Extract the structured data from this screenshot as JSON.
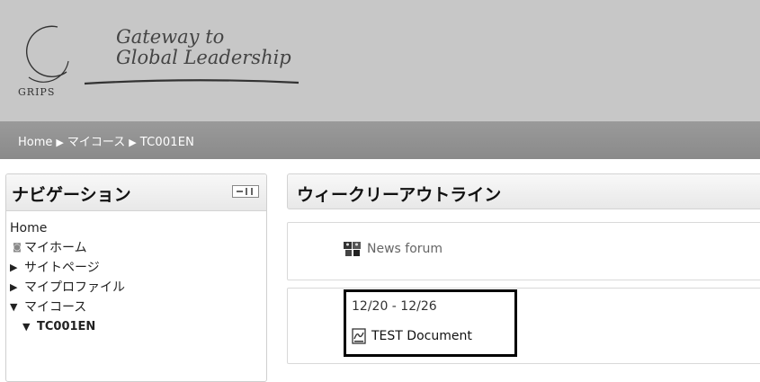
{
  "header": {
    "logo_text": "GRIPS",
    "tagline_line1": "Gateway to",
    "tagline_line2": "Global Leadership"
  },
  "breadcrumb": {
    "items": [
      "Home",
      "マイコース",
      "TC001EN"
    ],
    "separator": "▶"
  },
  "navigation": {
    "title": "ナビゲーション",
    "home": "Home",
    "items": [
      {
        "label": "マイホーム",
        "icon": "bullet"
      },
      {
        "label": "サイトページ",
        "icon": "arrow-right"
      },
      {
        "label": "マイプロファイル",
        "icon": "arrow-right"
      },
      {
        "label": "マイコース",
        "icon": "arrow-down"
      },
      {
        "label": "TC001EN",
        "icon": "arrow-down"
      }
    ]
  },
  "main": {
    "title": "ウィークリーアウトライン",
    "forum_label": "News forum",
    "week_dates": "12/20 - 12/26",
    "document_label": "TEST Document"
  },
  "colors": {
    "header_bg": "#c7c7c7",
    "breadcrumb_bg": "#8f8f8f",
    "highlight_border": "#000000"
  }
}
